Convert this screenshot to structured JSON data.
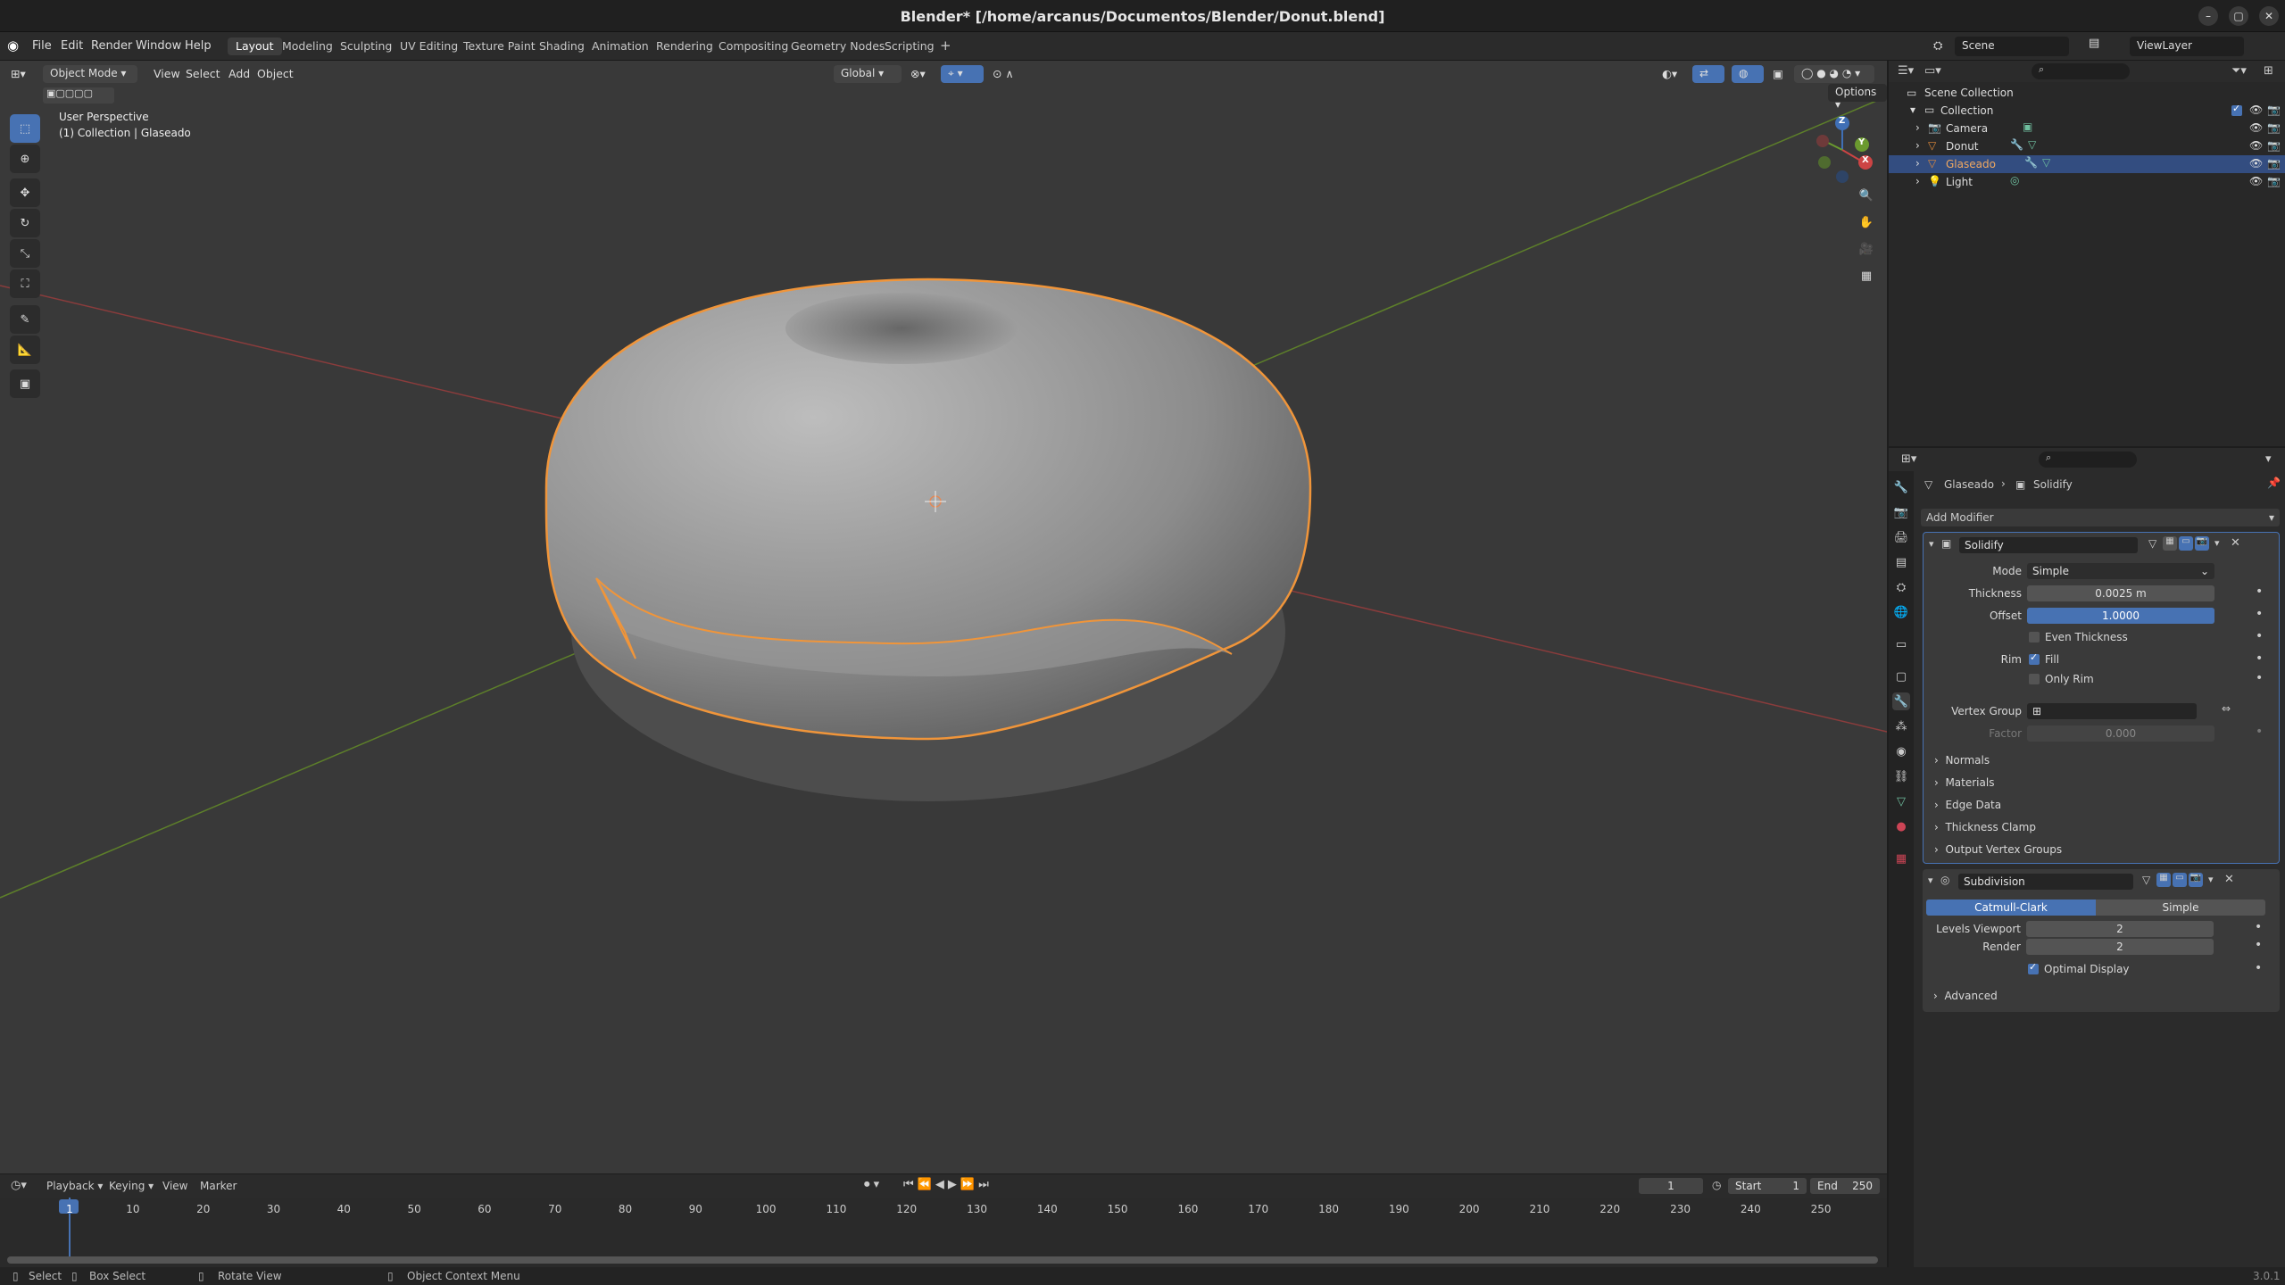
{
  "window": {
    "title": "Blender* [/home/arcanus/Documentos/Blender/Donut.blend]"
  },
  "menu": [
    "File",
    "Edit",
    "Render",
    "Window",
    "Help"
  ],
  "workspaces": [
    "Layout",
    "Modeling",
    "Sculpting",
    "UV Editing",
    "Texture Paint",
    "Shading",
    "Animation",
    "Rendering",
    "Compositing",
    "Geometry Nodes",
    "Scripting"
  ],
  "scene": {
    "name": "Scene",
    "view_layer": "ViewLayer"
  },
  "viewport": {
    "mode": "Object Mode",
    "menus": [
      "View",
      "Select",
      "Add",
      "Object"
    ],
    "orientation": "Global",
    "options_label": "Options",
    "overlay_line1": "User Perspective",
    "overlay_line2": "(1) Collection | Glaseado",
    "gizmo": {
      "x": "X",
      "y": "Y",
      "z": "Z"
    }
  },
  "outliner": {
    "root": "Scene Collection",
    "collection": "Collection",
    "items": [
      "Camera",
      "Donut",
      "Glaseado",
      "Light"
    ],
    "selected": "Glaseado"
  },
  "properties": {
    "breadcrumb_object": "Glaseado",
    "breadcrumb_modifier": "Solidify",
    "add_modifier": "Add Modifier",
    "solidify": {
      "name": "Solidify",
      "mode_label": "Mode",
      "mode_value": "Simple",
      "thickness_label": "Thickness",
      "thickness_value": "0.0025 m",
      "offset_label": "Offset",
      "offset_value": "1.0000",
      "offset_fraction": 1.0,
      "even_thickness": "Even Thickness",
      "rim_label": "Rim",
      "fill": "Fill",
      "only_rim": "Only Rim",
      "vertex_group_label": "Vertex Group",
      "factor_label": "Factor",
      "factor_value": "0.000",
      "subpanels": [
        "Normals",
        "Materials",
        "Edge Data",
        "Thickness Clamp",
        "Output Vertex Groups"
      ]
    },
    "subdivision": {
      "name": "Subdivision",
      "catmull": "Catmull-Clark",
      "simple": "Simple",
      "levels_viewport_label": "Levels Viewport",
      "levels_viewport_value": "2",
      "render_label": "Render",
      "render_value": "2",
      "optimal_display": "Optimal Display",
      "advanced": "Advanced"
    }
  },
  "timeline": {
    "menus": [
      "Playback",
      "Keying",
      "View",
      "Marker"
    ],
    "current_frame": "1",
    "start_label": "Start",
    "start_value": "1",
    "end_label": "End",
    "end_value": "250",
    "ticks": [
      "1",
      "10",
      "20",
      "30",
      "40",
      "50",
      "60",
      "70",
      "80",
      "90",
      "100",
      "110",
      "120",
      "130",
      "140",
      "150",
      "160",
      "170",
      "180",
      "190",
      "200",
      "210",
      "220",
      "230",
      "240",
      "250"
    ]
  },
  "status": {
    "select": "Select",
    "box_select": "Box Select",
    "rotate_view": "Rotate View",
    "context_menu": "Object Context Menu",
    "version": "3.0.1"
  },
  "colors": {
    "accent": "#4772b3",
    "selection_outline": "#f0953a",
    "x_axis": "#b54545",
    "y_axis": "#6b9a2f"
  }
}
